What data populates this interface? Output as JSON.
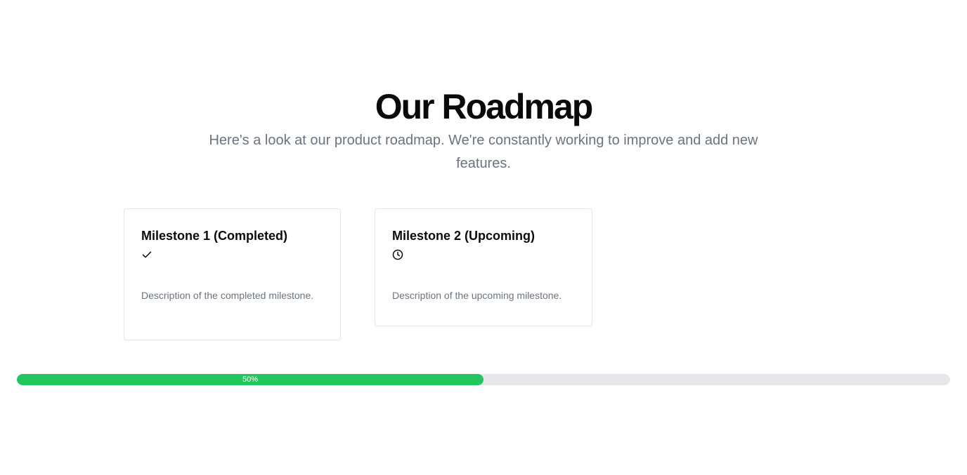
{
  "header": {
    "title": "Our Roadmap",
    "subtitle": "Here's a look at our product roadmap. We're constantly working to improve and add new features."
  },
  "milestones": [
    {
      "title": "Milestone 1 (Completed)",
      "icon": "check-icon",
      "description": "Description of the completed milestone."
    },
    {
      "title": "Milestone 2 (Upcoming)",
      "icon": "clock-icon",
      "description": "Description of the upcoming milestone."
    }
  ],
  "progress": {
    "value": 50,
    "label": "50%"
  },
  "colors": {
    "accent": "#22c55e",
    "track": "#e5e7eb",
    "muted_text": "#6b7280"
  }
}
